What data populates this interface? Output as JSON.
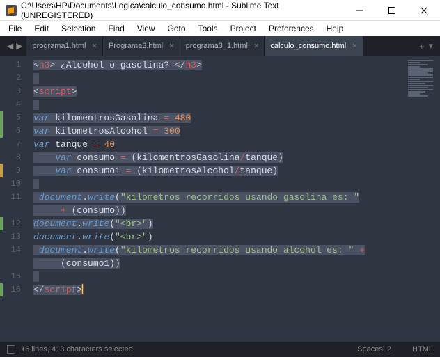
{
  "window": {
    "title": "C:\\Users\\HP\\Documents\\Logica\\calculo_consumo.html - Sublime Text (UNREGISTERED)"
  },
  "menu": [
    "File",
    "Edit",
    "Selection",
    "Find",
    "View",
    "Goto",
    "Tools",
    "Project",
    "Preferences",
    "Help"
  ],
  "tabs": [
    {
      "label": "programa1.html",
      "active": false
    },
    {
      "label": "Programa3.html",
      "active": false
    },
    {
      "label": "programa3_1.html",
      "active": false
    },
    {
      "label": "calculo_consumo.html",
      "active": true
    }
  ],
  "code": {
    "l1a": "<",
    "l1b": "h3",
    "l1c": ">",
    "l1d": " ¿Alcohol o gasolina? ",
    "l1e": "</",
    "l1f": "h3",
    "l1g": ">",
    "l3a": "<",
    "l3b": "script",
    "l3c": ">",
    "l5a": "var",
    "l5b": " kilomentrosGasolina ",
    "l5c": "=",
    "l5d": " 480",
    "l6a": "var",
    "l6b": " kilometrosAlcohol ",
    "l6c": "=",
    "l6d": " 300",
    "l7a": "var",
    "l7b": " tanque ",
    "l7c": "=",
    "l7d": " 40",
    "l8a": "    var",
    "l8b": " consumo ",
    "l8c": "=",
    "l8d": " (",
    "l8e": "kilomentrosGasolina",
    "l8f": "/",
    "l8g": "tanque",
    "l8h": ")",
    "l9a": "    var",
    "l9b": " consumo1 ",
    "l9c": "=",
    "l9d": " (",
    "l9e": "kilometrosAlcohol",
    "l9f": "/",
    "l9g": "tanque",
    "l9h": ")",
    "l11a": " document",
    "l11b": ".",
    "l11c": "write",
    "l11d": "(",
    "l11e": "\"kilometros recorridos usando gasolina es: \"",
    "l11fa": "     ",
    "l11fb": "+",
    "l11fc": " (consumo))",
    "l12a": "document",
    "l12b": ".",
    "l12c": "write",
    "l12d": "(",
    "l12e": "\"<br>\"",
    "l12f": ")",
    "l13a": "document",
    "l13b": ".",
    "l13c": "write",
    "l13d": "(",
    "l13e": "\"<br>\"",
    "l13f": ")",
    "l14a": " document",
    "l14b": ".",
    "l14c": "write",
    "l14d": "(",
    "l14e": "\"kilometros recorridos usando alcohol es: \"",
    "l14f": " +",
    "l14ga": "     (consumo1))",
    "l16a": "</",
    "l16b": "script",
    "l16c": ">"
  },
  "line_numbers": [
    "1",
    "2",
    "3",
    "4",
    "5",
    "6",
    "7",
    "8",
    "9",
    "10",
    "11",
    "",
    "12",
    "13",
    "14",
    "",
    "15",
    "16"
  ],
  "status": {
    "selection": "16 lines, 413 characters selected",
    "spaces": "Spaces: 2",
    "syntax": "HTML"
  }
}
